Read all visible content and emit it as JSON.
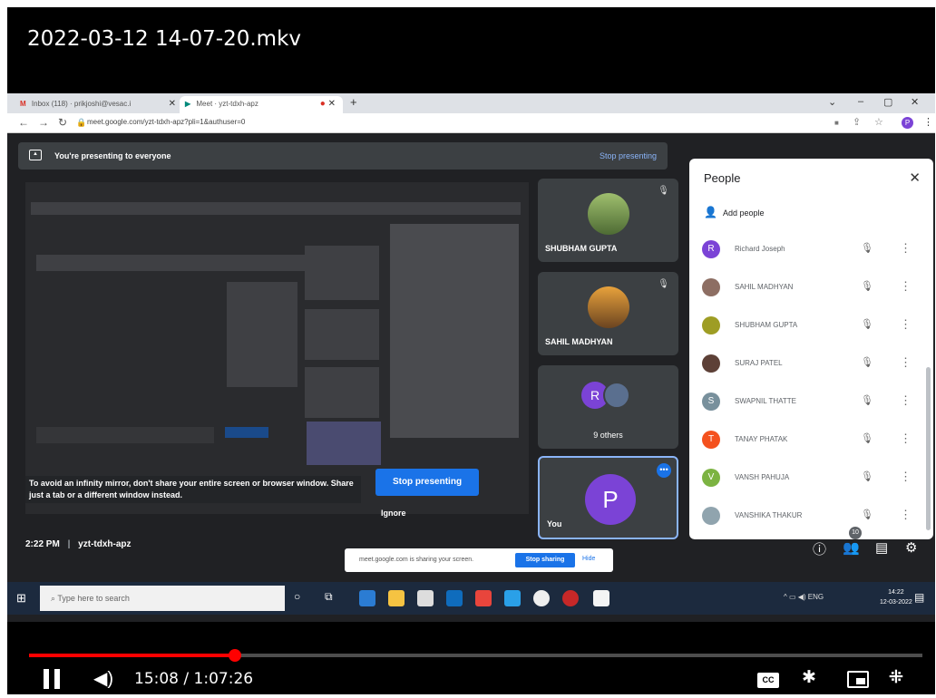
{
  "video": {
    "title": "2022-03-12 14-07-20.mkv",
    "current_time": "15:08",
    "separator": " / ",
    "duration": "1:07:26",
    "progress_fraction": 0.23
  },
  "browser": {
    "tabs": [
      {
        "icon": "M",
        "label": "Inbox (118) · prikjoshi@vesac.i"
      },
      {
        "icon": "▶",
        "label": "Meet · yzt-tdxh-apz"
      }
    ],
    "url": "meet.google.com/yzt-tdxh-apz?pli=1&authuser=0"
  },
  "meet": {
    "banner_text": "You're presenting to everyone",
    "banner_stop": "Stop presenting",
    "infinity_message": "To avoid an infinity mirror, don't share your entire screen or browser window. Share just a tab or a different window instead.",
    "stop_presenting_button": "Stop presenting",
    "ignore_button": "Ignore",
    "tiles": [
      {
        "name": "SHUBHAM GUPTA"
      },
      {
        "name": "SAHIL MADHYAN"
      },
      {
        "name": "9 others",
        "avatar_letter": "R"
      },
      {
        "name": "You",
        "avatar_letter": "P"
      }
    ],
    "footer_time": "2:22 PM",
    "footer_divider": "|",
    "meeting_code": "yzt-tdxh-apz",
    "sharing_notice": "meet.google.com is sharing your screen.",
    "sharing_stop": "Stop sharing",
    "sharing_hide": "Hide",
    "participant_count": "10"
  },
  "people_panel": {
    "title": "People",
    "add_people": "Add people",
    "people": [
      {
        "name": "Richard Joseph",
        "initial": "R",
        "color": "#7b43d6"
      },
      {
        "name": "SAHIL MADHYAN",
        "initial": "",
        "color": "#8d6e63"
      },
      {
        "name": "SHUBHAM GUPTA",
        "initial": "",
        "color": "#9e9d24"
      },
      {
        "name": "SURAJ PATEL",
        "initial": "",
        "color": "#5d4037"
      },
      {
        "name": "SWAPNIL THATTE",
        "initial": "S",
        "color": "#78909c"
      },
      {
        "name": "TANAY PHATAK",
        "initial": "T",
        "color": "#f4511e"
      },
      {
        "name": "VANSH PAHUJA",
        "initial": "V",
        "color": "#7cb342"
      },
      {
        "name": "VANSHIKA THAKUR",
        "initial": "",
        "color": "#90a4ae"
      }
    ]
  },
  "taskbar": {
    "search_placeholder": "Type here to search",
    "tray_text": "ENG",
    "clock_time": "14:22",
    "clock_date": "12-03-2022"
  }
}
